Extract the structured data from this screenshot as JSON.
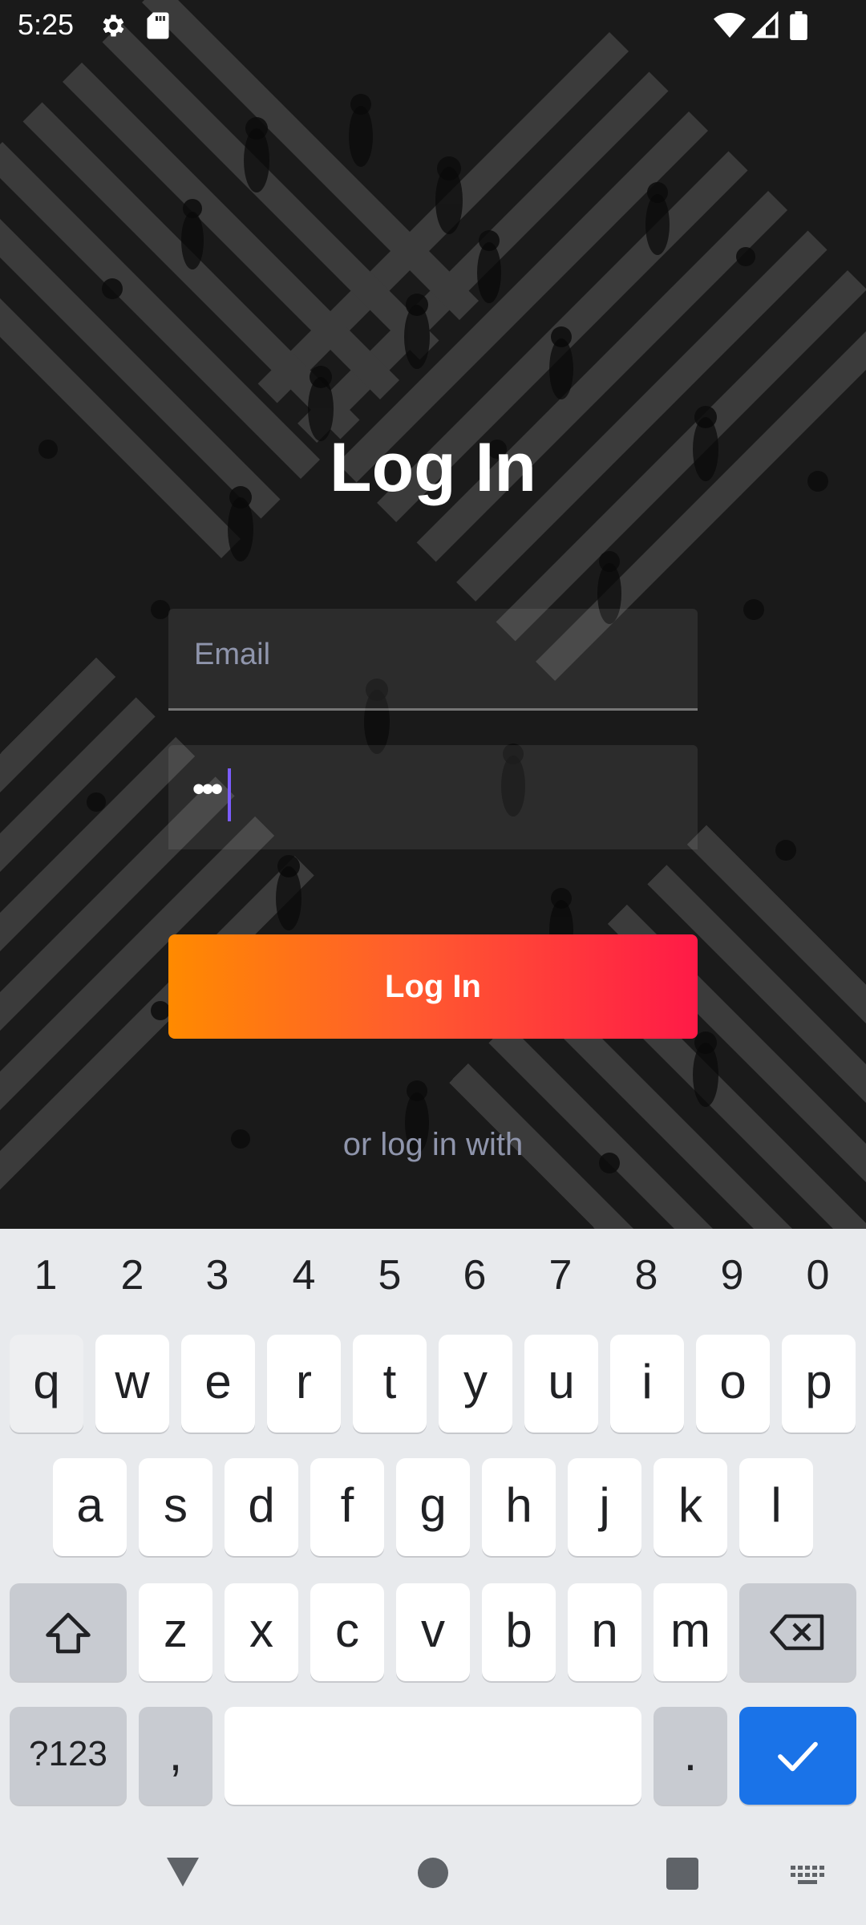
{
  "status_bar": {
    "time": "5:25",
    "icons": [
      "gear-icon",
      "sd-card-icon",
      "wifi-icon",
      "signal-icon",
      "battery-icon"
    ]
  },
  "login": {
    "title": "Log In",
    "email_placeholder": "Email",
    "password_value": "•••",
    "login_button": "Log In",
    "alt_login_text": "or log in with"
  },
  "keyboard": {
    "numbers": [
      "1",
      "2",
      "3",
      "4",
      "5",
      "6",
      "7",
      "8",
      "9",
      "0"
    ],
    "row1": [
      "q",
      "w",
      "e",
      "r",
      "t",
      "y",
      "u",
      "i",
      "o",
      "p"
    ],
    "row2": [
      "a",
      "s",
      "d",
      "f",
      "g",
      "h",
      "j",
      "k",
      "l"
    ],
    "row3": [
      "z",
      "x",
      "c",
      "v",
      "b",
      "n",
      "m"
    ],
    "symbols_key": "?123",
    "comma_key": ",",
    "period_key": ".",
    "shift_icon": "shift-icon",
    "backspace_icon": "backspace-icon",
    "enter_icon": "checkmark-icon"
  },
  "nav_bar": {
    "icons": [
      "back-triangle-icon",
      "home-circle-icon",
      "recents-square-icon",
      "keyboard-switch-icon"
    ]
  },
  "colors": {
    "button_gradient_start": "#ff8a00",
    "button_gradient_end": "#ff1a47",
    "placeholder": "#8f95ac",
    "caret": "#7b5cff",
    "enter_key": "#1a73e8"
  }
}
